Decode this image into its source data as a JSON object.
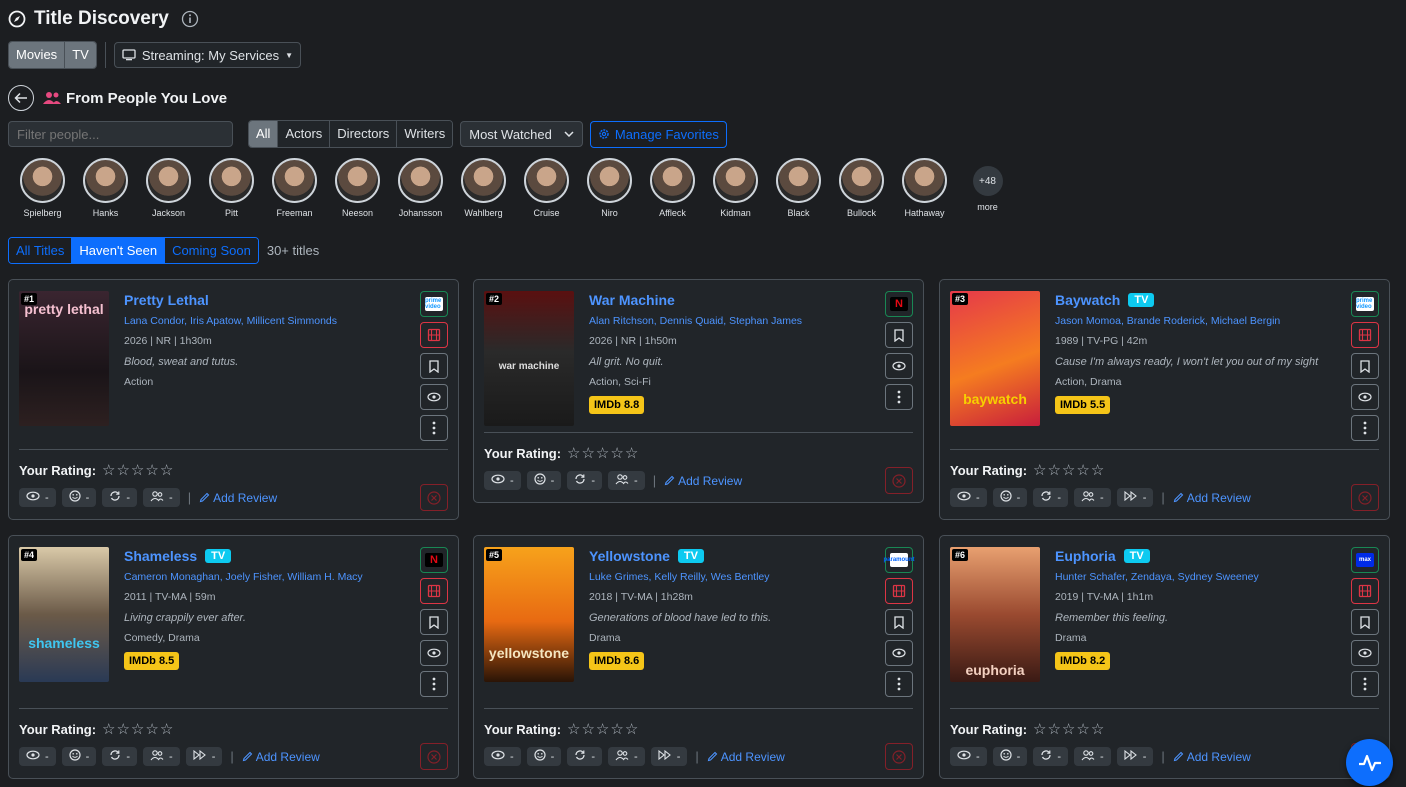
{
  "header": {
    "title": "Title Discovery"
  },
  "media_toggle": [
    {
      "label": "Movies",
      "active": true
    },
    {
      "label": "TV",
      "active": false
    }
  ],
  "streaming": {
    "label": "Streaming: My Services"
  },
  "section": {
    "title": "From People You Love"
  },
  "filter": {
    "placeholder": "Filter people..."
  },
  "role_tabs": [
    {
      "label": "All",
      "active": true
    },
    {
      "label": "Actors"
    },
    {
      "label": "Directors"
    },
    {
      "label": "Writers"
    }
  ],
  "sort": {
    "label": "Most Watched"
  },
  "manage": {
    "label": "Manage Favorites"
  },
  "people": [
    "Spielberg",
    "Hanks",
    "Jackson",
    "Pitt",
    "Freeman",
    "Neeson",
    "Johansson",
    "Wahlberg",
    "Cruise",
    "Niro",
    "Affleck",
    "Kidman",
    "Black",
    "Bullock",
    "Hathaway"
  ],
  "more": {
    "count": "+48",
    "label": "more"
  },
  "view_tabs": [
    {
      "label": "All Titles"
    },
    {
      "label": "Haven't Seen",
      "active": true
    },
    {
      "label": "Coming Soon"
    }
  ],
  "count_label": "30+ titles",
  "rating_label": "Your Rating:",
  "add_review": "Add Review",
  "chip_value": "-",
  "colors": {
    "accent": "#0d6efd",
    "imdb": "#f5c518",
    "tv": "#0dcaf0",
    "danger": "#dc3545"
  },
  "cards": [
    {
      "rank": "#1",
      "title": "Pretty Lethal",
      "tv": false,
      "cast": "Lana Condor, Iris Apatow, Millicent Simmonds",
      "meta": "2026 | NR | 1h30m",
      "tagline": "Blood, sweat and tutus.",
      "genre": "Action",
      "imdb": "",
      "service": "prime video",
      "poster_text": "PRETTY LETHAL",
      "chips": 4
    },
    {
      "rank": "#2",
      "title": "War Machine",
      "tv": false,
      "cast": "Alan Ritchson, Dennis Quaid, Stephan James",
      "meta": "2026 | NR | 1h50m",
      "tagline": "All grit. No quit.",
      "genre": "Action, Sci-Fi",
      "imdb": "IMDb 8.8",
      "service": "N",
      "poster_text": "WAR MACHINE",
      "chips": 4
    },
    {
      "rank": "#3",
      "title": "Baywatch",
      "tv": true,
      "cast": "Jason Momoa, Brande Roderick, Michael Bergin",
      "meta": "1989 | TV-PG | 42m",
      "tagline": "Cause I'm always ready, I won't let you out of my sight",
      "genre": "Action, Drama",
      "imdb": "IMDb 5.5",
      "service": "prime video",
      "poster_text": "BAYWATCH",
      "chips": 5
    },
    {
      "rank": "#4",
      "title": "Shameless",
      "tv": true,
      "cast": "Cameron Monaghan, Joely Fisher, William H. Macy",
      "meta": "2011 | TV-MA | 59m",
      "tagline": "Living crappily ever after.",
      "genre": "Comedy, Drama",
      "imdb": "IMDb 8.5",
      "service": "N",
      "poster_text": "shameless",
      "chips": 5
    },
    {
      "rank": "#5",
      "title": "Yellowstone",
      "tv": true,
      "cast": "Luke Grimes, Kelly Reilly, Wes Bentley",
      "meta": "2018 | TV-MA | 1h28m",
      "tagline": "Generations of blood have led to this.",
      "genre": "Drama",
      "imdb": "IMDb 8.6",
      "service": "paramount",
      "poster_text": "YELLOWSTONE",
      "chips": 5
    },
    {
      "rank": "#6",
      "title": "Euphoria",
      "tv": true,
      "cast": "Hunter Schafer, Zendaya, Sydney Sweeney",
      "meta": "2019 | TV-MA | 1h1m",
      "tagline": "Remember this feeling.",
      "genre": "Drama",
      "imdb": "IMDb 8.2",
      "service": "max",
      "poster_text": "euphoria",
      "chips": 5
    }
  ]
}
